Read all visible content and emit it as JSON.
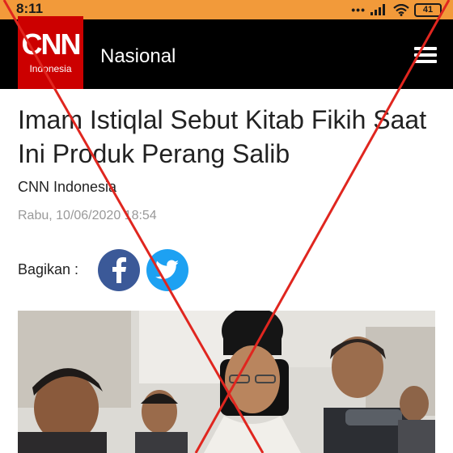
{
  "status": {
    "time": "8:11",
    "battery": "41",
    "icons": [
      "more-dots-icon",
      "signal-icon",
      "wifi-icon",
      "battery-icon"
    ]
  },
  "header": {
    "logo_text": "CNN",
    "logo_subtext": "Indonesia",
    "section": "Nasional",
    "menu_icon": "hamburger-menu-icon"
  },
  "article": {
    "headline": "Imam Istiqlal Sebut Kitab Fikih Saat Ini Produk Perang Salib",
    "author": "CNN Indonesia",
    "timestamp": "Rabu, 10/06/2020 18:54"
  },
  "share": {
    "label": "Bagikan :",
    "buttons": [
      "facebook-icon",
      "twitter-icon"
    ]
  },
  "colors": {
    "status_bar": "#f29a3a",
    "header_bg": "#000000",
    "brand_red": "#cc0000",
    "facebook": "#3b5998",
    "twitter": "#1da1f2",
    "overlay_cross": "#e0261f"
  }
}
